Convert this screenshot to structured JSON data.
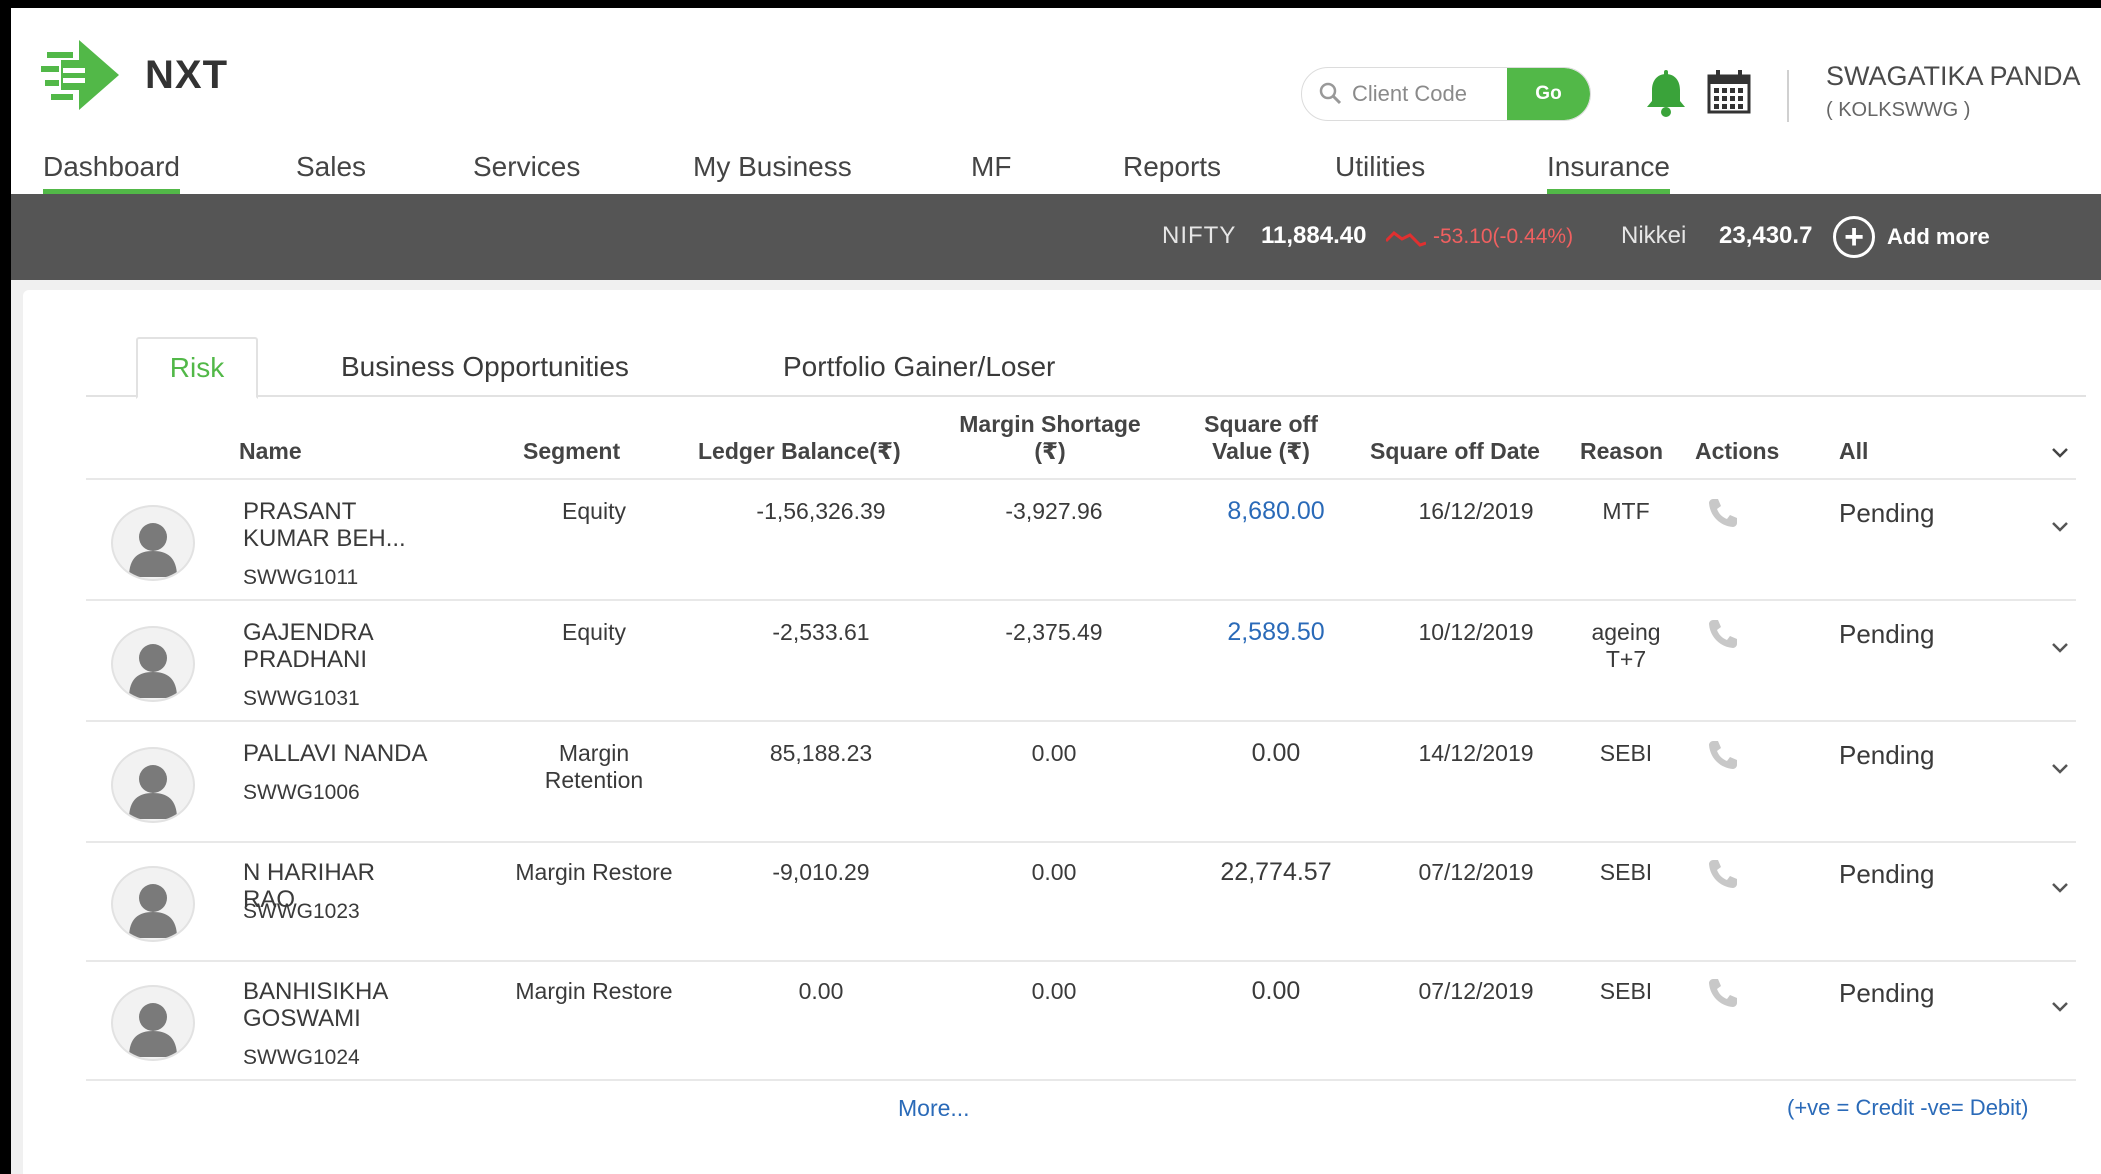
{
  "app": {
    "logo_text": "NXT"
  },
  "search": {
    "placeholder": "Client Code",
    "go_label": "Go"
  },
  "user": {
    "name": "SWAGATIKA PANDA",
    "code": "( KOLKSWWG )"
  },
  "nav": {
    "items": [
      "Dashboard",
      "Sales",
      "Services",
      "My Business",
      "MF",
      "Reports",
      "Utilities",
      "Insurance"
    ]
  },
  "ticker": {
    "index1_name": "NIFTY",
    "index1_value": "11,884.40",
    "index1_change": "-53.10(-0.44%)",
    "index2_name": "Nikkei",
    "index2_value": "23,430.7",
    "add_more_label": "Add more"
  },
  "tabs": [
    "Risk",
    "Business Opportunities",
    "Portfolio Gainer/Loser"
  ],
  "table": {
    "headers": {
      "name": "Name",
      "segment": "Segment",
      "ledger_balance": "Ledger Balance(₹)",
      "margin_shortage_1": "Margin Shortage",
      "margin_shortage_2": "(₹)",
      "square_off_value_1": "Square off",
      "square_off_value_2": "Value (₹)",
      "square_off_date": "Square off Date",
      "reason": "Reason",
      "actions": "Actions",
      "filter": "All"
    },
    "rows": [
      {
        "name1": "PRASANT",
        "name2": "KUMAR BEH...",
        "code": "SWWG1011",
        "segment1": "Equity",
        "segment2": "",
        "ledger": "-1,56,326.39",
        "margin": "-3,927.96",
        "sqvalue": "8,680.00",
        "sqdate": "16/12/2019",
        "reason1": "MTF",
        "reason2": "",
        "status": "Pending"
      },
      {
        "name1": "GAJENDRA",
        "name2": "PRADHANI",
        "code": "SWWG1031",
        "segment1": "Equity",
        "segment2": "",
        "ledger": "-2,533.61",
        "margin": "-2,375.49",
        "sqvalue": "2,589.50",
        "sqdate": "10/12/2019",
        "reason1": "ageing",
        "reason2": "T+7",
        "status": "Pending"
      },
      {
        "name1": "PALLAVI NANDA",
        "name2": "",
        "code": "SWWG1006",
        "segment1": "Margin",
        "segment2": "Retention",
        "ledger": "85,188.23",
        "margin": "0.00",
        "sqvalue": "0.00",
        "sqdate": "14/12/2019",
        "reason1": "SEBI",
        "reason2": "",
        "status": "Pending"
      },
      {
        "name1": "N HARIHAR RAO",
        "name2": "",
        "code": "SWWG1023",
        "segment1": "Margin Restore",
        "segment2": "",
        "ledger": "-9,010.29",
        "margin": "0.00",
        "sqvalue": "22,774.57",
        "sqdate": "07/12/2019",
        "reason1": "SEBI",
        "reason2": "",
        "status": "Pending"
      },
      {
        "name1": "BANHISIKHA",
        "name2": "GOSWAMI",
        "code": "SWWG1024",
        "segment1": "Margin Restore",
        "segment2": "",
        "ledger": "0.00",
        "margin": "0.00",
        "sqvalue": "0.00",
        "sqdate": "07/12/2019",
        "reason1": "SEBI",
        "reason2": "",
        "status": "Pending"
      }
    ]
  },
  "footer": {
    "more": "More...",
    "legend": "(+ve = Credit   -ve= Debit)"
  },
  "colors": {
    "accent": "#52b848",
    "ticker_bg": "#555555",
    "negative": "#f06060",
    "link": "#2a6ab8"
  }
}
